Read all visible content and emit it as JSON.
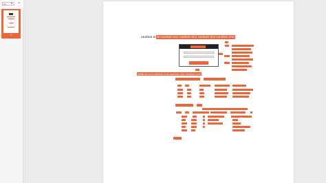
{
  "toolbar": {
    "zoom_value": "Fit...",
    "caret_icon": "chevron-down-icon",
    "close_icon": "close-icon"
  },
  "sidebar": {
    "pages": [
      {
        "number": "1",
        "selected": true
      }
    ]
  },
  "document": {
    "title_plain": "random te",
    "title_highlighted": "xt random text random text random text random text",
    "subtitle": "random text random text random text random text"
  },
  "colors": {
    "highlight": "#e9663a",
    "page": "#ffffff",
    "background": "#ebebeb"
  }
}
